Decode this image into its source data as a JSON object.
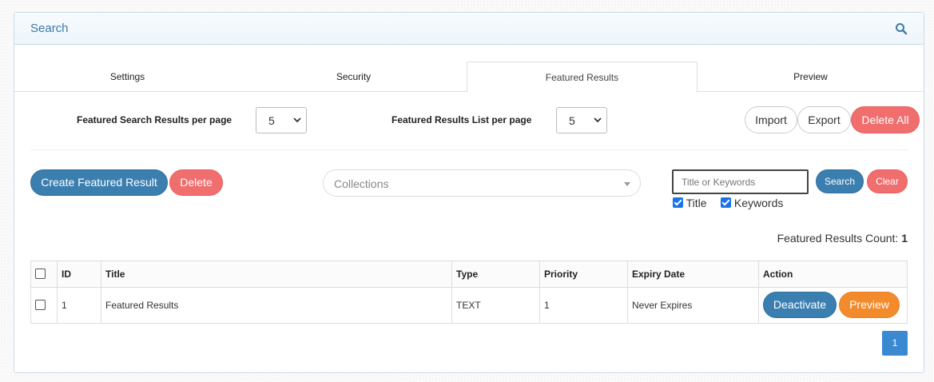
{
  "header": {
    "title": "Search",
    "icon": "search-icon"
  },
  "tabs": [
    {
      "label": "Settings",
      "active": false
    },
    {
      "label": "Security",
      "active": false
    },
    {
      "label": "Featured Results",
      "active": true
    },
    {
      "label": "Preview",
      "active": false
    }
  ],
  "settings": {
    "search_per_page_label": "Featured Search Results per page",
    "search_per_page_value": "5",
    "list_per_page_label": "Featured Results List per page",
    "list_per_page_value": "5"
  },
  "toolbar": {
    "import_label": "Import",
    "export_label": "Export",
    "delete_all_label": "Delete All"
  },
  "actions": {
    "create_label": "Create Featured Result",
    "delete_label": "Delete"
  },
  "collections": {
    "placeholder": "Collections"
  },
  "search": {
    "placeholder": "Title or Keywords",
    "value": "",
    "search_label": "Search",
    "clear_label": "Clear",
    "title_check_label": "Title",
    "title_checked": true,
    "keywords_check_label": "Keywords",
    "keywords_checked": true
  },
  "count": {
    "label": "Featured Results Count:",
    "value": "1"
  },
  "table": {
    "headers": {
      "id": "ID",
      "title": "Title",
      "type": "Type",
      "priority": "Priority",
      "expiry": "Expiry Date",
      "action": "Action"
    },
    "rows": [
      {
        "id": "1",
        "title": "Featured Results",
        "type": "TEXT",
        "priority": "1",
        "expiry": "Never Expires",
        "deactivate_label": "Deactivate",
        "preview_label": "Preview"
      }
    ]
  },
  "pagination": {
    "current": "1"
  },
  "colors": {
    "accent_blue": "#3b7fb0",
    "danger_red": "#f06e6e",
    "warning_orange": "#f38b2c",
    "page_blue": "#3a89d1"
  }
}
